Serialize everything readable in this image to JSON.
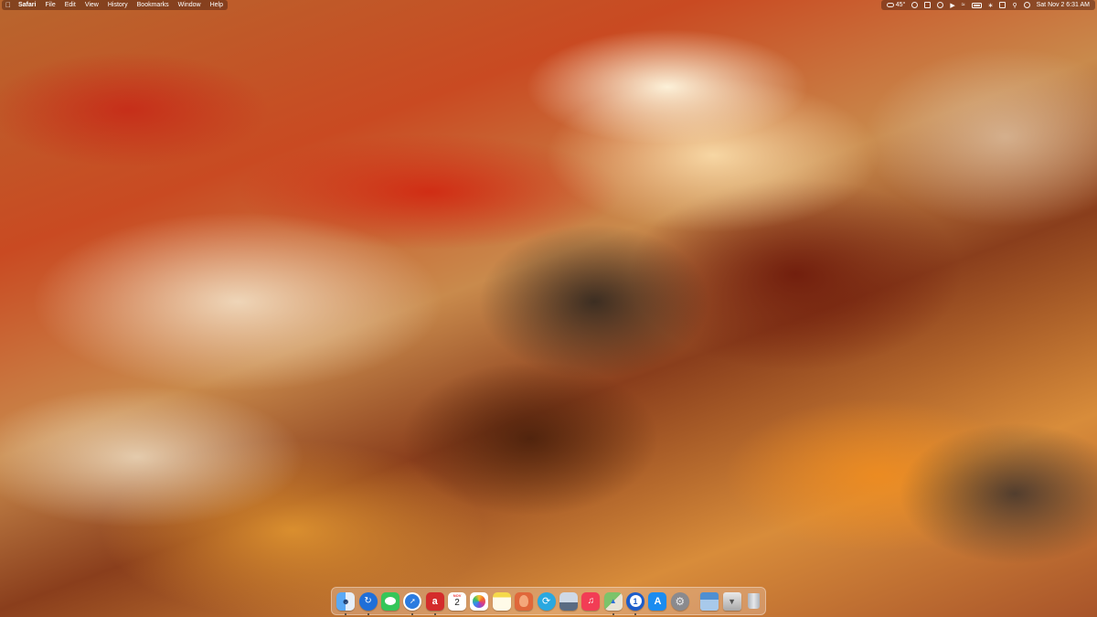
{
  "menubar": {
    "app_name": "Safari",
    "menus": [
      "File",
      "Edit",
      "View",
      "History",
      "Bookmarks",
      "Window",
      "Help"
    ],
    "status": {
      "weather": "45°",
      "datetime": "Sat Nov 2  6:31 AM"
    }
  },
  "dock": {
    "calendar": {
      "month": "NOV",
      "day": "2"
    },
    "apps": [
      {
        "name": "Finder",
        "color": "#3d8ef0",
        "icon": "finder-icon",
        "running": true
      },
      {
        "name": "Safari Preview",
        "color": "#1f6fd8",
        "icon": "refresh-icon",
        "running": true
      },
      {
        "name": "Messages",
        "color": "#35c659",
        "icon": "speech-bubble-icon",
        "running": false
      },
      {
        "name": "Safari",
        "color": "#2b7be0",
        "icon": "compass-icon",
        "running": true
      },
      {
        "name": "App",
        "color": "#d42b2b",
        "icon": "a-letter-icon",
        "running": true
      },
      {
        "name": "Calendar",
        "color": "#ffffff",
        "icon": "calendar-icon",
        "running": false
      },
      {
        "name": "Photos",
        "color": "#ffffff",
        "icon": "flower-icon",
        "running": false
      },
      {
        "name": "Notes",
        "color": "#f5e27a",
        "icon": "note-icon",
        "running": false
      },
      {
        "name": "Creature",
        "color": "#e0673a",
        "icon": "creature-icon",
        "running": false
      },
      {
        "name": "Swirl",
        "color": "#2aa8e0",
        "icon": "swirl-icon",
        "running": false
      },
      {
        "name": "Preview",
        "color": "#8aa6c8",
        "icon": "photo-viewer-icon",
        "running": false
      },
      {
        "name": "Music",
        "color": "#f23d55",
        "icon": "music-note-icon",
        "running": false
      },
      {
        "name": "Maps",
        "color": "#5fb35f",
        "icon": "map-icon",
        "running": true
      },
      {
        "name": "1Password",
        "color": "#1c5cc9",
        "icon": "key-icon",
        "running": true
      },
      {
        "name": "App Store",
        "color": "#1b8cf0",
        "icon": "app-store-icon",
        "running": false
      },
      {
        "name": "System Settings",
        "color": "#8a8a8e",
        "icon": "gear-icon",
        "running": false
      }
    ],
    "stacks": [
      {
        "name": "Desktop",
        "color": "#7aa7d8",
        "icon": "folder-stack-icon"
      },
      {
        "name": "Downloads",
        "color": "#b8b8b8",
        "icon": "downloads-icon"
      },
      {
        "name": "Trash",
        "color": "#c8ccd2",
        "icon": "trash-icon"
      }
    ]
  }
}
